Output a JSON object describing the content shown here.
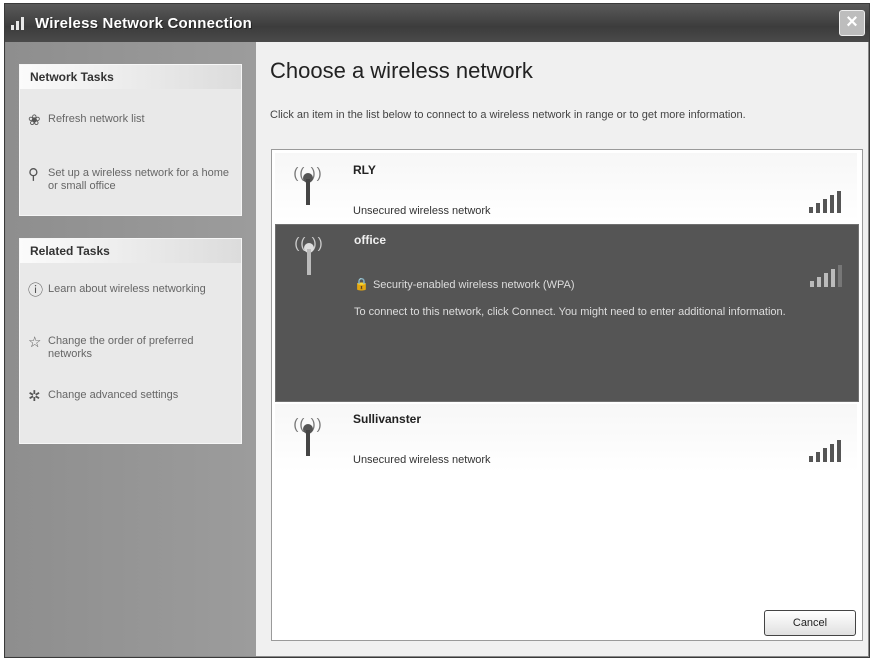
{
  "window": {
    "title": "Wireless Network Connection"
  },
  "sidebar": {
    "network_tasks": {
      "header": "Network Tasks",
      "items": [
        {
          "label": "Refresh network list",
          "icon": "refresh-icon"
        },
        {
          "label": "Set up a wireless network for a home or small office",
          "icon": "setup-network-icon"
        }
      ]
    },
    "related_tasks": {
      "header": "Related Tasks",
      "items": [
        {
          "label": "Learn about wireless networking",
          "icon": "info-icon"
        },
        {
          "label": "Change the order of preferred networks",
          "icon": "star-icon"
        },
        {
          "label": "Change advanced settings",
          "icon": "settings-icon"
        }
      ]
    }
  },
  "main": {
    "heading": "Choose a wireless network",
    "instruction": "Click an item in the list below to connect to a wireless network in range or to get more information.",
    "networks": [
      {
        "name": "RLY",
        "status": "Unsecured wireless network",
        "signal_bars": 5
      },
      {
        "name": "office",
        "status": "Security-enabled wireless network (WPA)",
        "signal_bars": 4,
        "description": "To connect to this network, click Connect. You might need to enter additional information."
      },
      {
        "name": "Sullivanster",
        "status": "Unsecured wireless network",
        "signal_bars": 5
      }
    ],
    "cancel_label": "Cancel"
  },
  "colors": {
    "selected_row": "#555555",
    "titlebar": "#3c3c3c",
    "sidebar": "#8e8e8e"
  }
}
